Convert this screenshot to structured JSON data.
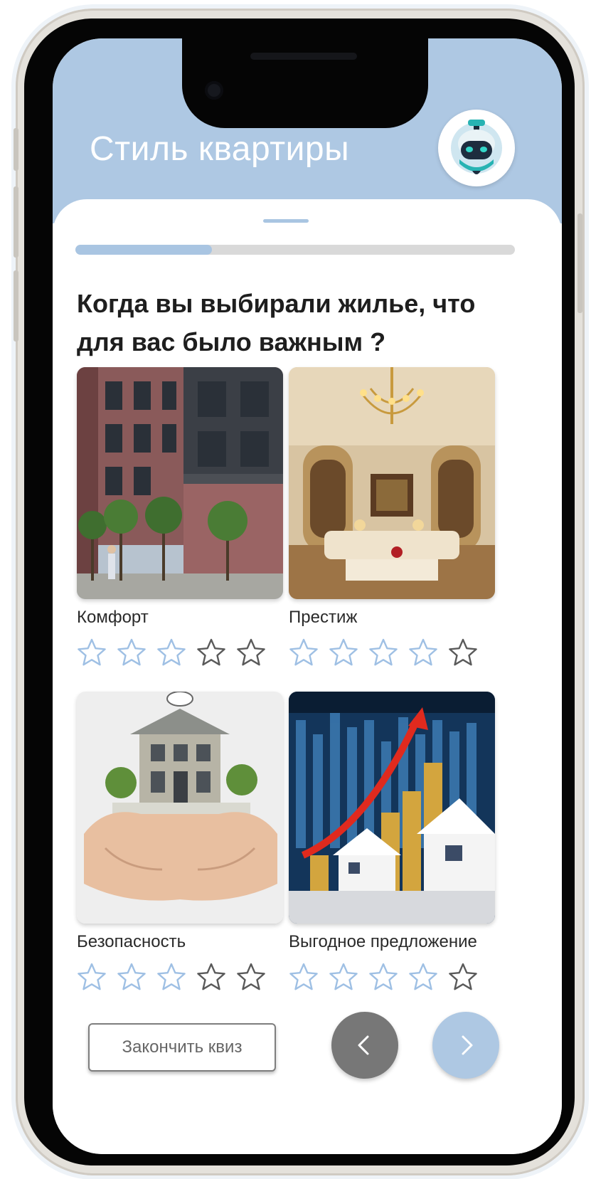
{
  "header": {
    "title": "Стиль квартиры",
    "avatar_icon": "robot-assistant-icon"
  },
  "quiz": {
    "progress_fraction": 0.31,
    "question": "Когда вы выбирали жилье, что для вас было важным ?",
    "options": [
      {
        "label": "Комфорт",
        "rating": 3,
        "max_rating": 5,
        "image": "apartment-building-photo"
      },
      {
        "label": "Престиж",
        "rating": 4,
        "max_rating": 5,
        "image": "luxury-interior-photo"
      },
      {
        "label": "Безопасность",
        "rating": 3,
        "max_rating": 5,
        "image": "house-in-hands-photo"
      },
      {
        "label": "Выгодное предложение",
        "rating": 4,
        "max_rating": 5,
        "image": "investment-growth-photo"
      }
    ]
  },
  "footer": {
    "finish_label": "Закончить квиз",
    "prev_icon": "chevron-left-icon",
    "next_icon": "chevron-right-icon"
  },
  "colors": {
    "accent": "#aec8e3",
    "star_filled": "#9fc0e4",
    "star_empty": "#5a5a5a",
    "prev_button": "#777777"
  }
}
